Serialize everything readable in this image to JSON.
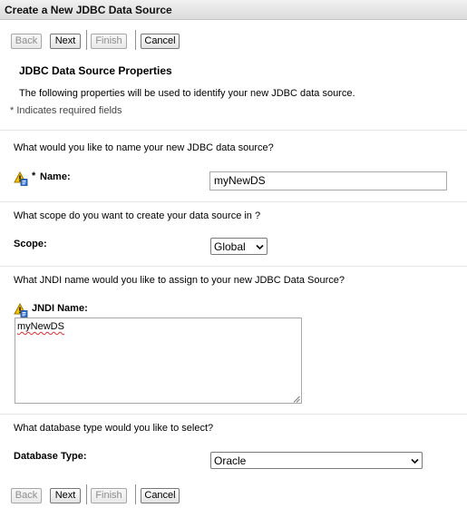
{
  "title": "Create a New JDBC Data Source",
  "toolbar": {
    "back": "Back",
    "next": "Next",
    "finish": "Finish",
    "cancel": "Cancel"
  },
  "section": {
    "heading": "JDBC Data Source Properties",
    "description": "The following properties will be used to identify your new JDBC data source.",
    "required_note": "* Indicates required fields"
  },
  "name_field": {
    "question": "What would you like to name your new JDBC data source?",
    "required_marker": "*",
    "label": "Name:",
    "value": "myNewDS"
  },
  "scope_field": {
    "question": "What scope do you want to create your data source in ?",
    "label": "Scope:",
    "value": "Global"
  },
  "jndi_field": {
    "question": "What JNDI name would you like to assign to your new JDBC Data Source?",
    "label": "JNDI Name:",
    "value": "myNewDS"
  },
  "dbtype_field": {
    "question": "What database type would you like to select?",
    "label": "Database Type:",
    "value": "Oracle"
  },
  "icons": {
    "help": "warning-help-icon",
    "dropdown": "chevron-down-icon",
    "resize": "resize-grip-icon"
  },
  "colors": {
    "titlebar": "#dcdcdc",
    "separator": "#e6e6e6",
    "spellcheck": "#e03030"
  }
}
